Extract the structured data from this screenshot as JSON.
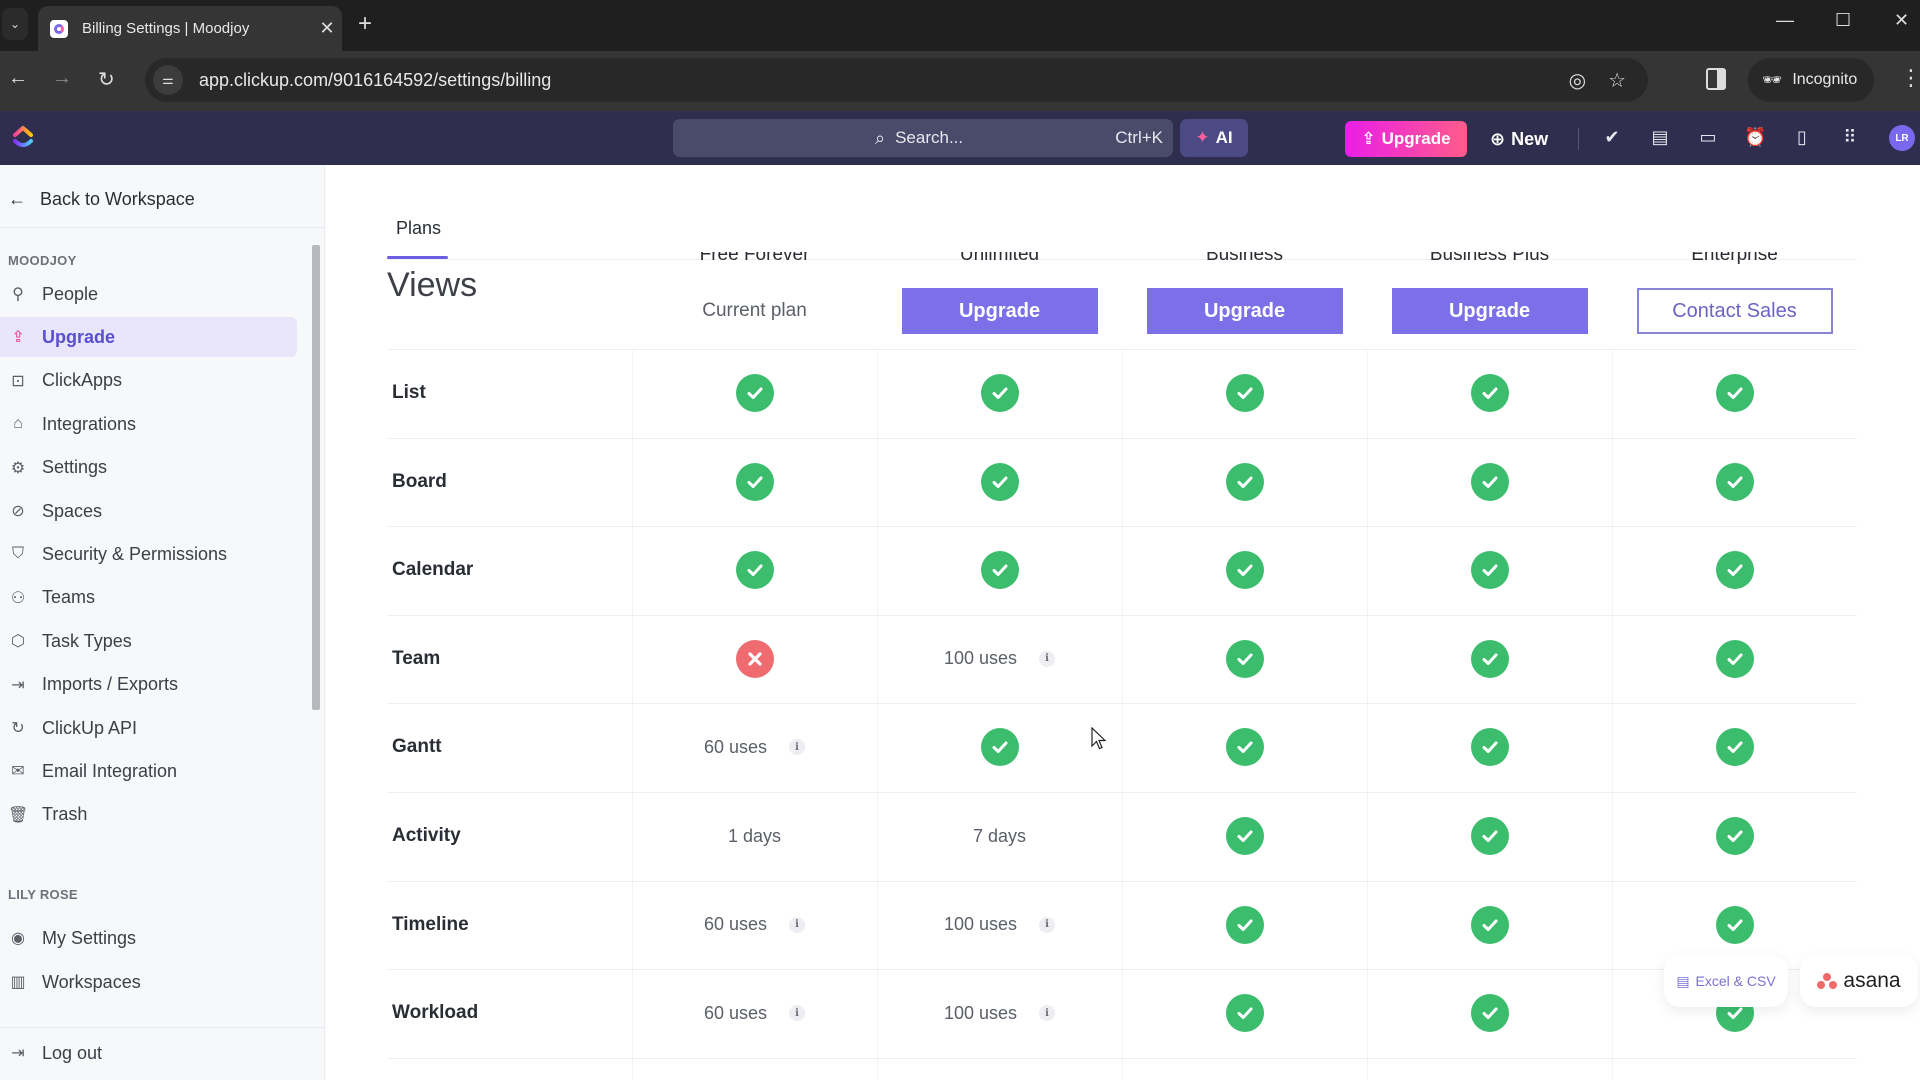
{
  "browser": {
    "tab_title": "Billing Settings | Moodjoy",
    "url": "app.clickup.com/9016164592/settings/billing",
    "profile_label": "Incognito"
  },
  "app_header": {
    "search_placeholder": "Search...",
    "search_shortcut": "Ctrl+K",
    "ai_label": "AI",
    "upgrade_label": "Upgrade",
    "new_label": "New",
    "avatar_initials": "LR"
  },
  "sidebar": {
    "back_label": "Back to Workspace",
    "workspace_section": "MOODJOY",
    "workspace_items": [
      {
        "label": "People",
        "icon": "person-icon",
        "active": false
      },
      {
        "label": "Upgrade",
        "icon": "upgrade-icon",
        "active": true
      },
      {
        "label": "ClickApps",
        "icon": "clickapps-icon",
        "active": false
      },
      {
        "label": "Integrations",
        "icon": "puzzle-icon",
        "active": false
      },
      {
        "label": "Settings",
        "icon": "gear-icon",
        "active": false
      },
      {
        "label": "Spaces",
        "icon": "planet-icon",
        "active": false
      },
      {
        "label": "Security & Permissions",
        "icon": "shield-icon",
        "active": false
      },
      {
        "label": "Teams",
        "icon": "team-icon",
        "active": false
      },
      {
        "label": "Task Types",
        "icon": "cube-icon",
        "active": false
      },
      {
        "label": "Imports / Exports",
        "icon": "import-icon",
        "active": false
      },
      {
        "label": "ClickUp API",
        "icon": "api-icon",
        "active": false
      },
      {
        "label": "Email Integration",
        "icon": "mail-icon",
        "active": false
      },
      {
        "label": "Trash",
        "icon": "trash-icon",
        "active": false
      }
    ],
    "user_section": "LILY ROSE",
    "user_items": [
      {
        "label": "My Settings",
        "icon": "user-circle-icon"
      },
      {
        "label": "Workspaces",
        "icon": "workspaces-icon"
      }
    ],
    "logout_label": "Log out"
  },
  "main": {
    "tab_label": "Plans",
    "section_title": "Views",
    "plans": [
      {
        "name": "Free Forever",
        "cta": "Current plan",
        "cta_style": "plain"
      },
      {
        "name": "Unlimited",
        "cta": "Upgrade",
        "cta_style": "primary"
      },
      {
        "name": "Business",
        "cta": "Upgrade",
        "cta_style": "primary"
      },
      {
        "name": "Business Plus",
        "cta": "Upgrade",
        "cta_style": "primary"
      },
      {
        "name": "Enterprise",
        "cta": "Contact Sales",
        "cta_style": "outline"
      }
    ],
    "rows": [
      {
        "feature": "List",
        "values": [
          "check",
          "check",
          "check",
          "check",
          "check"
        ]
      },
      {
        "feature": "Board",
        "values": [
          "check",
          "check",
          "check",
          "check",
          "check"
        ]
      },
      {
        "feature": "Calendar",
        "values": [
          "check",
          "check",
          "check",
          "check",
          "check"
        ]
      },
      {
        "feature": "Team",
        "values": [
          "cross",
          "100 uses|info",
          "check",
          "check",
          "check"
        ]
      },
      {
        "feature": "Gantt",
        "values": [
          "60 uses|info",
          "check",
          "check",
          "check",
          "check"
        ]
      },
      {
        "feature": "Activity",
        "values": [
          "1 days",
          "7 days",
          "check",
          "check",
          "check"
        ]
      },
      {
        "feature": "Timeline",
        "values": [
          "60 uses|info",
          "100 uses|info",
          "check",
          "check",
          "check"
        ]
      },
      {
        "feature": "Workload",
        "values": [
          "60 uses|info",
          "100 uses|info",
          "check",
          "check",
          "check"
        ]
      }
    ]
  },
  "floating": {
    "excel_label": "Excel & CSV",
    "asana_label": "asana"
  },
  "colors": {
    "accent": "#7b70e8",
    "check": "#3cbd6e",
    "cross": "#ef6b6f",
    "header_bg": "#2f2e4e"
  }
}
